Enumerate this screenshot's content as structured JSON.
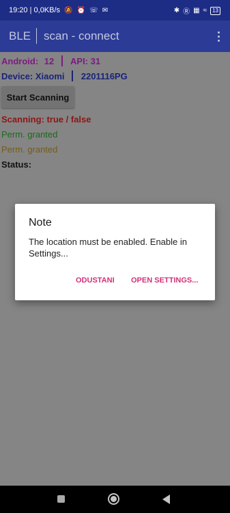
{
  "status_bar": {
    "time": "19:20",
    "network_speed": "0,0KB/s",
    "left_icons": [
      "mute-bell-icon",
      "alarm-icon",
      "viber-icon",
      "mail-icon"
    ],
    "right_icons": [
      "bluetooth-icon",
      "bold-icon",
      "signal-icon",
      "wifi-icon"
    ],
    "battery": "13"
  },
  "app_bar": {
    "title": "BLE",
    "subtitle": "scan - connect"
  },
  "info": {
    "android_label": "Android:",
    "android_value": "12",
    "api_label": "API:",
    "api_value": "31",
    "device_label": "Device:",
    "device_brand": "Xiaomi",
    "device_model": "2201116PG",
    "scanning": "Scanning: true / false",
    "perm1": "Perm. granted",
    "perm2": "Perm. granted",
    "status": "Status:"
  },
  "scan_button": "Start Scanning",
  "dialog": {
    "title": "Note",
    "message": "The location must be enabled. Enable in Settings...",
    "cancel": "ODUSTANI",
    "confirm": "OPEN SETTINGS..."
  },
  "colors": {
    "status_bar": "#1d2d86",
    "app_bar": "#2c3b95",
    "accent": "#d4307a",
    "scrim_background": "#858585"
  }
}
